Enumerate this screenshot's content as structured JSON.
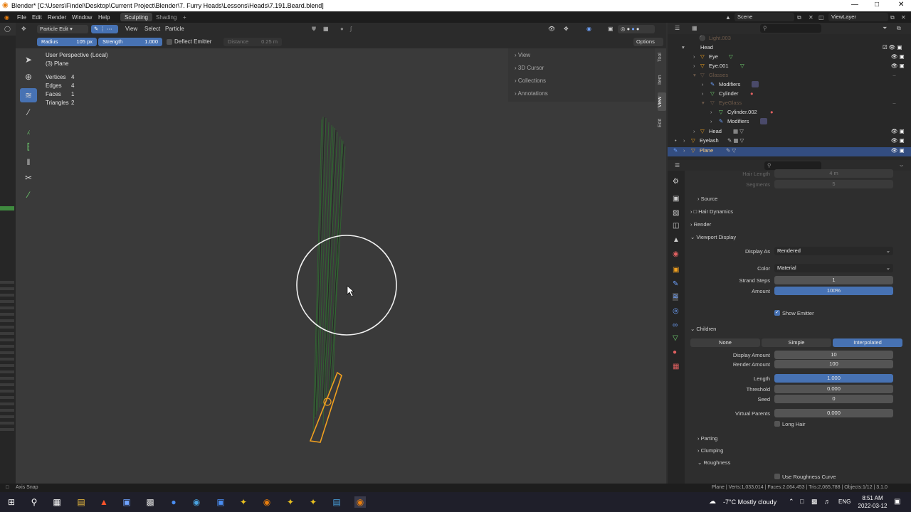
{
  "window": {
    "title": "Blender* [C:\\Users\\Findel\\Desktop\\Current Project\\Blender\\7. Furry Heads\\Lessons\\Heads\\7.191.Beard.blend]"
  },
  "menu": {
    "items": [
      "File",
      "Edit",
      "Render",
      "Window",
      "Help"
    ],
    "workspaces": [
      "Sculpting",
      "Shading"
    ],
    "add_tab": "+",
    "scene": "Scene",
    "view_layer": "ViewLayer"
  },
  "header": {
    "mode": "Particle Edit",
    "menus": [
      "View",
      "Select",
      "Particle"
    ]
  },
  "tool_settings": {
    "radius_label": "Radius",
    "radius_value": "105 px",
    "strength_label": "Strength",
    "strength_value": "1.000",
    "deflect_emitter": "Deflect Emitter",
    "distance_label": "Distance",
    "distance_value": "0.25 m",
    "options": "Options"
  },
  "viewport": {
    "perspective": "User Perspective (Local)",
    "object": "(3) Plane",
    "stats": [
      {
        "label": "Vertices",
        "value": "4"
      },
      {
        "label": "Edges",
        "value": "4"
      },
      {
        "label": "Faces",
        "value": "1"
      },
      {
        "label": "Triangles",
        "value": "2"
      }
    ],
    "brush_fill": 0.0
  },
  "npanel": {
    "sections": [
      "View",
      "3D Cursor",
      "Collections",
      "Annotations"
    ],
    "tabs": [
      "Tool",
      "Item",
      "View",
      "Edit"
    ]
  },
  "outliner": {
    "rows": [
      "Light.003",
      "Head",
      "Eye",
      "Eye.001",
      "Glasses",
      "Modifiers",
      "Cylinder",
      "EyeGlass",
      "Cylinder.002",
      "Modifiers",
      "Head",
      "Eyelash",
      "Plane"
    ]
  },
  "properties": {
    "faded": [
      {
        "label": "Hair Length",
        "value": "4 m"
      },
      {
        "label": "Segments",
        "value": "5"
      }
    ],
    "sections": {
      "source": "Source",
      "hair_dynamics": "Hair Dynamics",
      "render": "Render",
      "viewport_display": "Viewport Display",
      "children": "Children"
    },
    "display_as_label": "Display As",
    "display_as_value": "Rendered",
    "color_label": "Color",
    "color_value": "Material",
    "strand_steps_label": "Strand Steps",
    "strand_steps_value": "1",
    "amount_label": "Amount",
    "amount_value": "100%",
    "show_emitter": "Show Emitter",
    "child_modes": [
      "None",
      "Simple",
      "Interpolated"
    ],
    "display_amount_label": "Display Amount",
    "display_amount_value": "10",
    "render_amount_label": "Render Amount",
    "render_amount_value": "100",
    "length_label": "Length",
    "length_value": "1.000",
    "threshold_label": "Threshold",
    "threshold_value": "0.000",
    "seed_label": "Seed",
    "seed_value": "0",
    "virtual_parents_label": "Virtual Parents",
    "virtual_parents_value": "0.000",
    "long_hair": "Long Hair",
    "subsections": [
      "Parting",
      "Clumping",
      "Roughness"
    ],
    "use_roughness_curve": "Use Roughness Curve"
  },
  "status": {
    "left": "Axis Snap",
    "right": "Plane | Verts:1,033,014 | Faces:2,064,453 | Tris:2,065,788 | Objects:1/12 | 3.1.0"
  },
  "taskbar": {
    "weather": "-7°C  Mostly cloudy",
    "lang": "ENG",
    "time": "8:51 AM",
    "date": "2022-03-12"
  },
  "colors": {
    "accent": "#4772b3",
    "selected_orange": "#f0a020",
    "hair_green": "#3fa040"
  }
}
